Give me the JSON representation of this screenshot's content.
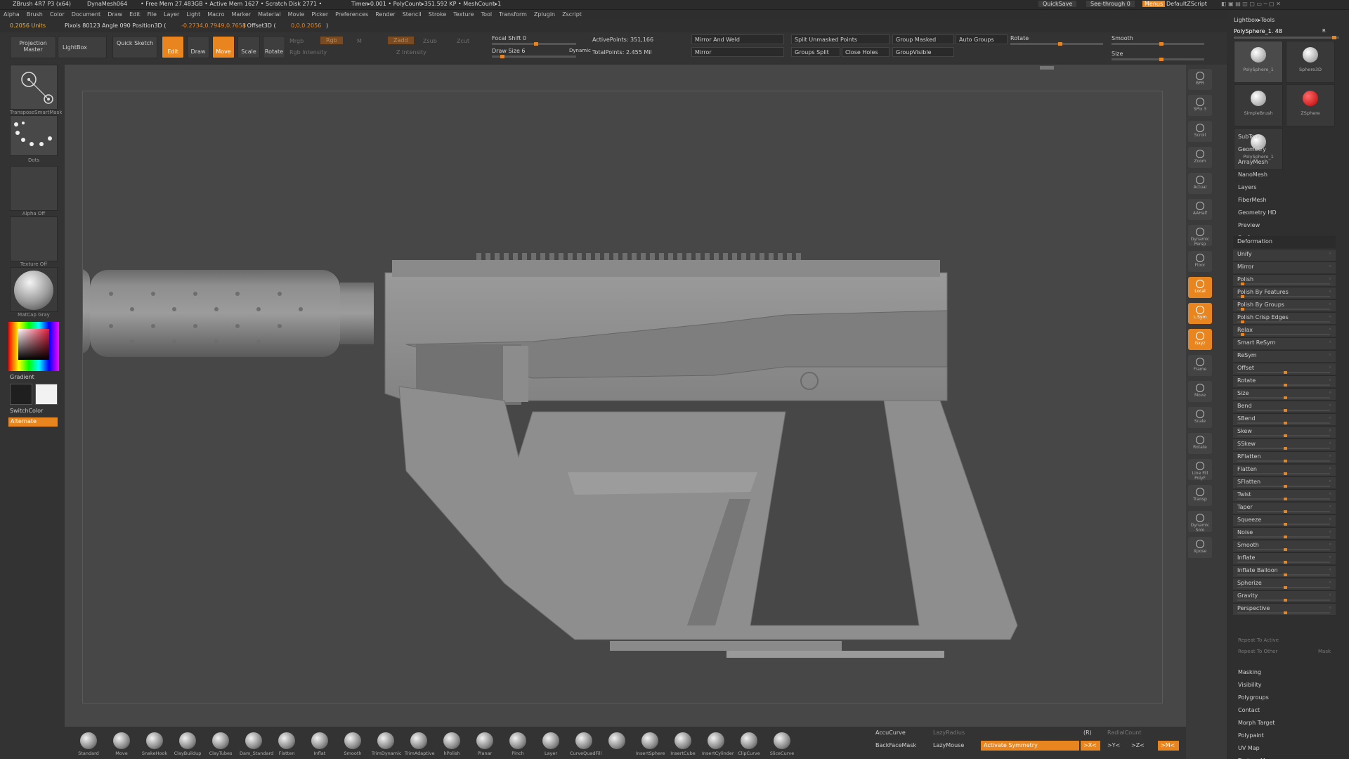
{
  "colors": {
    "accent": "#e8851f",
    "bg": "#474747",
    "panel": "#333333",
    "tray": "#2f2f2f"
  },
  "titlebar": {
    "app": "ZBrush 4R7 P3 (x64)",
    "doc": "DynaMesh064",
    "mem": "• Free Mem 27.483GB • Active Mem 1627 • Scratch Disk 2771 •",
    "timer": "Timer▸0.001 • PolyCount▸351.592 KP • MeshCount▸1",
    "quicksave": "QuickSave",
    "seethrough": "See-through  0",
    "menus": "Menus",
    "zscript": "DefaultZScript"
  },
  "menubar": [
    "Alpha",
    "Brush",
    "Color",
    "Document",
    "Draw",
    "Edit",
    "File",
    "Layer",
    "Light",
    "Macro",
    "Marker",
    "Material",
    "Movie",
    "Picker",
    "Preferences",
    "Render",
    "Stencil",
    "Stroke",
    "Texture",
    "Tool",
    "Transform",
    "Zplugin",
    "Zscript"
  ],
  "status": {
    "units": "0.2056 Units",
    "pixols": "Pixols 80123 Angle 090 Position3D (",
    "position": "-0.2734,0.7949,0.7658",
    "offset_label": ") Offset3D (",
    "offset": "0,0,0.2056",
    "end": ")"
  },
  "toolbar": {
    "projection": "Projection Master",
    "lightbox": "LightBox",
    "quicksketch": "Quick Sketch",
    "edit": "Edit",
    "draw": "Draw",
    "move": "Move",
    "scale": "Scale",
    "rotate": "Rotate",
    "mrgb": "Mrgb",
    "rgb": "Rgb",
    "m": "M",
    "rgb_intensity": "Rgb Intensity",
    "zadd": "Zadd",
    "zsub": "Zsub",
    "zcut": "Zcut",
    "z_intensity": "Z Intensity",
    "focal_shift": "Focal Shift 0",
    "draw_size": "Draw Size 6",
    "dynamic": "Dynamic",
    "active_points": "ActivePoints: 351,166",
    "total_points": "TotalPoints: 2.455 Mil",
    "mirror_weld": "Mirror And Weld",
    "mirror": "Mirror",
    "split_unmasked": "Split Unmasked Points",
    "groups_split": "Groups Split",
    "close_holes": "Close Holes",
    "group_masked": "Group Masked",
    "group_visible": "GroupVisible",
    "auto_groups": "Auto Groups",
    "rotate_label": "Rotate",
    "smooth": "Smooth",
    "size": "Size"
  },
  "leftshelf": {
    "transpose": "TransposeSmartMask",
    "dots": "Dots",
    "alpha": "Alpha Off",
    "texture": "Texture Off",
    "matcap": "MatCap Gray",
    "gradient": "Gradient",
    "switchcolor": "SwitchColor",
    "alternate": "Alternate"
  },
  "rightshelf": [
    "BPR",
    "SPix 3",
    "Scroll",
    "Zoom",
    "Actual",
    "AAHalf",
    "Dynamic Persp",
    "Floor",
    "Local",
    "L.Sym",
    "Gxyz",
    "Frame",
    "Move",
    "Scale",
    "Rotate",
    "Line Fill PolyF",
    "Transp",
    "Dynamic Solo",
    "Xpose"
  ],
  "tray": {
    "header": "Lightbox▸Tools",
    "tool": "PolySphere_1. 48",
    "r": "R",
    "thumbs": [
      "PolySphere_1",
      "Sphere3D",
      "SimpleBrush",
      "ZSphere",
      "PolySphere_1"
    ],
    "menus": [
      "SubTool",
      "Geometry",
      "ArrayMesh",
      "NanoMesh",
      "Layers",
      "FiberMesh",
      "Geometry HD",
      "Preview",
      "Surface"
    ],
    "deformation": "Deformation",
    "rows": [
      {
        "n": "Unify",
        "v": 0
      },
      {
        "n": "Mirror",
        "v": 0
      },
      {
        "n": "Polish",
        "v": 0.04
      },
      {
        "n": "Polish By Features",
        "v": 0.04
      },
      {
        "n": "Polish By Groups",
        "v": 0.04
      },
      {
        "n": "Polish Crisp Edges",
        "v": 0.04
      },
      {
        "n": "Relax",
        "v": 0.04
      },
      {
        "n": "Smart ReSym",
        "v": 0
      },
      {
        "n": "ReSym",
        "v": 0
      },
      {
        "n": "Offset",
        "v": 0.5
      },
      {
        "n": "Rotate",
        "v": 0.5
      },
      {
        "n": "Size",
        "v": 0.5
      },
      {
        "n": "Bend",
        "v": 0.5
      },
      {
        "n": "SBend",
        "v": 0.5
      },
      {
        "n": "Skew",
        "v": 0.5
      },
      {
        "n": "SSkew",
        "v": 0.5
      },
      {
        "n": "RFlatten",
        "v": 0.5
      },
      {
        "n": "Flatten",
        "v": 0.5
      },
      {
        "n": "SFlatten",
        "v": 0.5
      },
      {
        "n": "Twist",
        "v": 0.5
      },
      {
        "n": "Taper",
        "v": 0.5
      },
      {
        "n": "Squeeze",
        "v": 0.5
      },
      {
        "n": "Noise",
        "v": 0.5
      },
      {
        "n": "Smooth",
        "v": 0.5
      },
      {
        "n": "Inflate",
        "v": 0.5
      },
      {
        "n": "Inflate Balloon",
        "v": 0.5
      },
      {
        "n": "Spherize",
        "v": 0.5
      },
      {
        "n": "Gravity",
        "v": 0.5
      },
      {
        "n": "Perspective",
        "v": 0.5
      }
    ],
    "repeat_active": "Repeat To Active",
    "repeat_other": "Repeat To Other",
    "mask": "Mask",
    "menus2": [
      "Masking",
      "Visibility",
      "Polygroups",
      "Contact",
      "Morph Target",
      "Polypaint",
      "UV Map",
      "Texture Map"
    ]
  },
  "brushes": [
    "Standard",
    "Move",
    "SnakeHook",
    "ClayBuildup",
    "ClayTubes",
    "Dam_Standard",
    "Flatten",
    "Inflat",
    "Smooth",
    "TrimDynamic",
    "TrimAdaptive",
    "hPolish",
    "Planar",
    "Pinch",
    "Layer",
    "CurveQuadFill",
    "",
    "InsertSphere",
    "InsertCube",
    "InsertCylinder",
    "ClipCurve",
    "SliceCurve"
  ],
  "bottom": {
    "accucurve": "AccuCurve",
    "lazyradius": "LazyRadius",
    "r": "(R)",
    "radialcount": "RadialCount",
    "backfacemask": "BackFaceMask",
    "lazymouse": "LazyMouse",
    "activate_symmetry": "Activate Symmetry",
    "x": ">X<",
    "y": ">Y<",
    "z": ">Z<",
    "m": ">M<"
  }
}
